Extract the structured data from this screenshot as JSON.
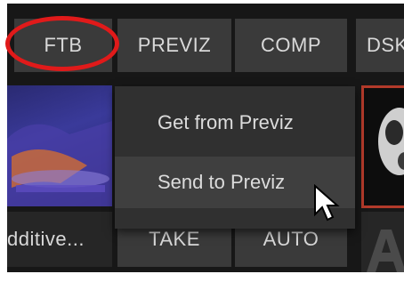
{
  "buttons": {
    "ftb": "FTB",
    "previz": "PREVIZ",
    "comp": "COMP",
    "dsk": "DSK",
    "take": "TAKE",
    "auto": "AUTO"
  },
  "source_label": "dditive...",
  "context_menu": {
    "items": [
      {
        "label": "Get from Previz"
      },
      {
        "label": "Send to Previz"
      }
    ]
  },
  "colors": {
    "panel": "#171717",
    "button": "#3a3a3a",
    "annotation_ring": "#e01a1a",
    "thumb_border": "#b23a2a"
  }
}
